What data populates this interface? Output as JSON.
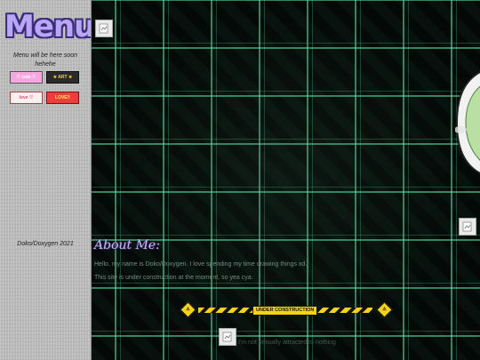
{
  "sidebar": {
    "logo_text": "Menu",
    "menu_note": "Menu will be here soon hehehe",
    "buttons": [
      {
        "label": "♡ cute ♡",
        "icon": "pink-button"
      },
      {
        "label": "★ ART ★",
        "icon": "dark-yellow-button"
      },
      {
        "label": "love ♡",
        "icon": "white-button"
      },
      {
        "label": "LOVE!!",
        "icon": "red-button"
      }
    ],
    "credit": "Doko/Doxygen 2021"
  },
  "main": {
    "about_title": "About Me:",
    "about_lines": [
      "Hello, my name is Doko/Doxygen. I love spending my time drawing things xd.",
      "This site is under construction at the moment, so yea cya."
    ],
    "construction": {
      "label": "UNDER CONSTRUCTION",
      "sign_left": "⚠",
      "sign_right": "⚠"
    },
    "disclaimer": "I'm not sexually attracted to nothing"
  },
  "colors": {
    "sidebar_bg": "#b9b9b9",
    "plaid_green": "#5ee6aa",
    "logo_purple": "#b9a6f4",
    "tape_yellow": "#f6d317"
  }
}
